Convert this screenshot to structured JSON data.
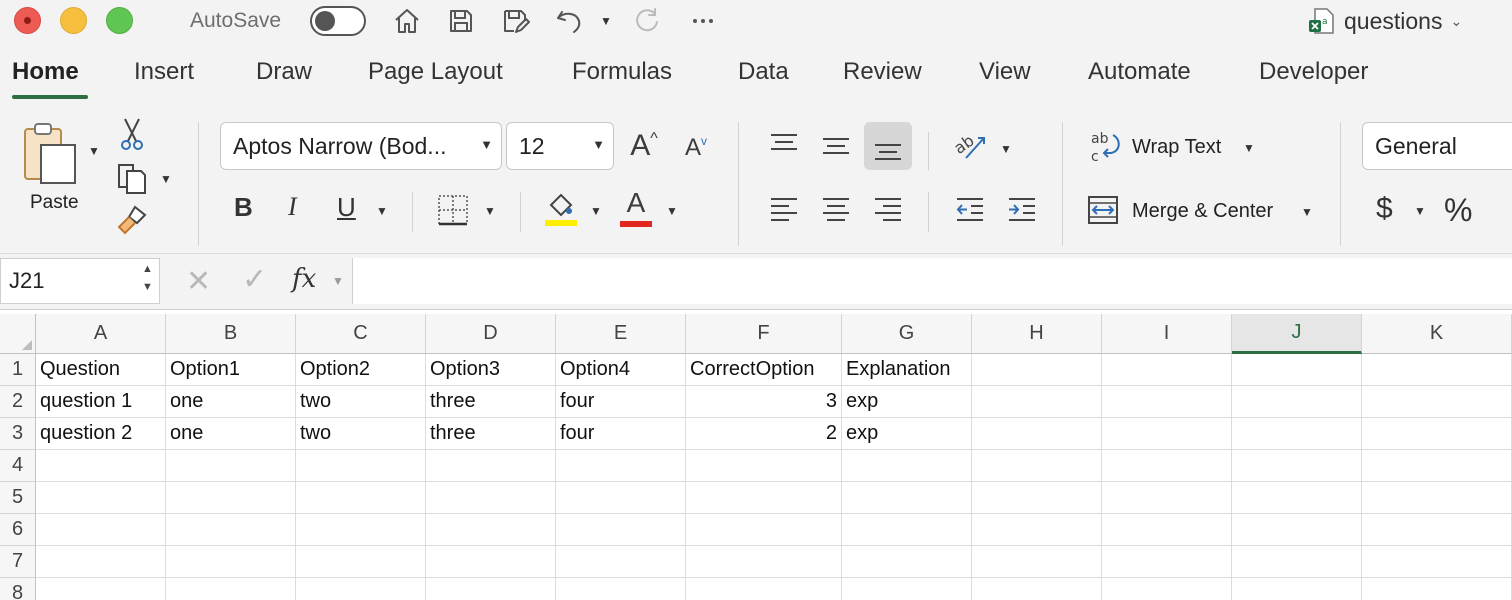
{
  "titlebar": {
    "autosave_label": "AutoSave",
    "doc_name": "questions",
    "icons": [
      "home-icon",
      "save-icon",
      "save-as-icon",
      "undo-icon",
      "redo-icon",
      "more-icon"
    ]
  },
  "tabs": [
    "Home",
    "Insert",
    "Draw",
    "Page Layout",
    "Formulas",
    "Data",
    "Review",
    "View",
    "Automate",
    "Developer"
  ],
  "active_tab": "Home",
  "ribbon": {
    "paste_label": "Paste",
    "font_name": "Aptos Narrow (Bod...",
    "font_size": "12",
    "bold": "B",
    "italic": "I",
    "underline": "U",
    "grow_font": "A",
    "shrink_font": "A",
    "font_color_letter": "A",
    "wrap_text_label": "Wrap Text",
    "merge_center_label": "Merge & Center",
    "number_format": "General",
    "currency_symbol": "$",
    "percent_symbol": "%",
    "highlight_color": "#ffee00",
    "font_color": "#e0261f"
  },
  "formula_bar": {
    "name_box": "J21",
    "fx_label": "fx",
    "value": ""
  },
  "sheet": {
    "columns": [
      "A",
      "B",
      "C",
      "D",
      "E",
      "F",
      "G",
      "H",
      "I",
      "J",
      "K"
    ],
    "selected_column": "J",
    "row_numbers": [
      "1",
      "2",
      "3",
      "4",
      "5",
      "6",
      "7",
      "8"
    ],
    "rows": [
      [
        "Question",
        "Option1",
        "Option2",
        "Option3",
        "Option4",
        "CorrectOption",
        "Explanation",
        "",
        "",
        "",
        ""
      ],
      [
        "question 1",
        "one",
        "two",
        "three",
        "four",
        "3",
        "exp",
        "",
        "",
        "",
        ""
      ],
      [
        "question 2",
        "one",
        "two",
        "three",
        "four",
        "2",
        "exp",
        "",
        "",
        "",
        ""
      ],
      [
        "",
        "",
        "",
        "",
        "",
        "",
        "",
        "",
        "",
        "",
        ""
      ],
      [
        "",
        "",
        "",
        "",
        "",
        "",
        "",
        "",
        "",
        "",
        ""
      ],
      [
        "",
        "",
        "",
        "",
        "",
        "",
        "",
        "",
        "",
        "",
        ""
      ],
      [
        "",
        "",
        "",
        "",
        "",
        "",
        "",
        "",
        "",
        "",
        ""
      ],
      [
        "",
        "",
        "",
        "",
        "",
        "",
        "",
        "",
        "",
        "",
        ""
      ]
    ]
  },
  "colors": {
    "accent_green": "#2c6e3f",
    "ribbon_bg": "#f3f3f3"
  }
}
